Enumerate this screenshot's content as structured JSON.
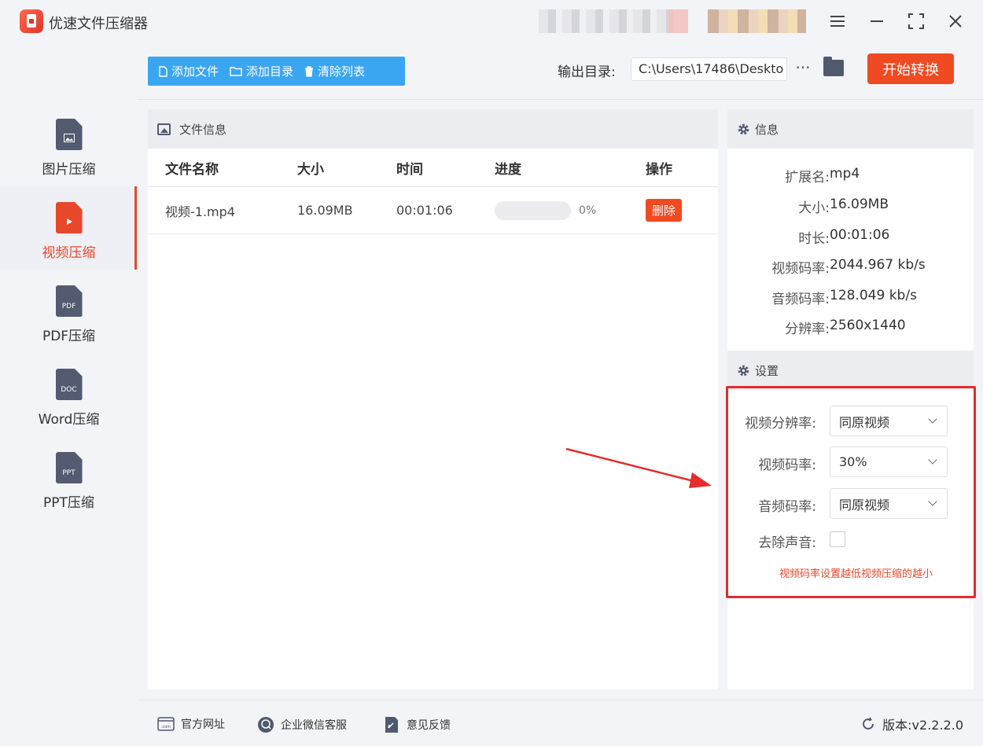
{
  "app": {
    "title": "优速文件压缩器",
    "window_buttons": [
      "menu-icon",
      "minimize-icon",
      "maximize-icon",
      "close-icon"
    ]
  },
  "sidebar": {
    "items": [
      {
        "label": "图片压缩",
        "icon": "image-file-icon",
        "icon_text": "",
        "active": false
      },
      {
        "label": "视频压缩",
        "icon": "video-file-icon",
        "icon_text": "",
        "active": true
      },
      {
        "label": "PDF压缩",
        "icon": "pdf-file-icon",
        "icon_text": "PDF",
        "active": false
      },
      {
        "label": "Word压缩",
        "icon": "doc-file-icon",
        "icon_text": "DOC",
        "active": false
      },
      {
        "label": "PPT压缩",
        "icon": "ppt-file-icon",
        "icon_text": "PPT",
        "active": false
      }
    ]
  },
  "toolbar": {
    "add_file": "添加文件",
    "add_dir": "添加目录",
    "clear_list": "清除列表",
    "output_label": "输出目录:",
    "output_path": "C:\\Users\\17486\\Deskto",
    "more": "···",
    "start": "开始转换"
  },
  "file_panel": {
    "header": "文件信息",
    "columns": [
      "文件名称",
      "大小",
      "时间",
      "进度",
      "操作"
    ],
    "rows": [
      {
        "name": "视频-1.mp4",
        "size": "16.09MB",
        "time": "00:01:06",
        "progress": 0,
        "progress_label": "0%",
        "action": "删除"
      }
    ]
  },
  "info_panel": {
    "header": "信息",
    "rows": [
      {
        "key": "扩展名:",
        "value": "mp4"
      },
      {
        "key": "大小:",
        "value": "16.09MB"
      },
      {
        "key": "时长:",
        "value": "00:01:06"
      },
      {
        "key": "视频码率:",
        "value": "2044.967 kb/s"
      },
      {
        "key": "音频码率:",
        "value": "128.049 kb/s"
      },
      {
        "key": "分辨率:",
        "value": "2560x1440"
      }
    ]
  },
  "settings": {
    "header": "设置",
    "video_resolution_label": "视频分辨率:",
    "video_resolution_value": "同原视频",
    "video_bitrate_label": "视频码率:",
    "video_bitrate_value": "30%",
    "audio_bitrate_label": "音频码率:",
    "audio_bitrate_value": "同原视频",
    "remove_audio_label": "去除声音:",
    "remove_audio_checked": false,
    "hint": "视频码率设置越低视频压缩的越小"
  },
  "footer": {
    "website": "官方网址",
    "wechat": "企业微信客服",
    "feedback": "意见反馈",
    "version": "版本:v2.2.2.0"
  },
  "colors": {
    "accent_blue": "#3aa6f2",
    "accent_red": "#f04a22",
    "highlight_red": "#e52b2b"
  }
}
